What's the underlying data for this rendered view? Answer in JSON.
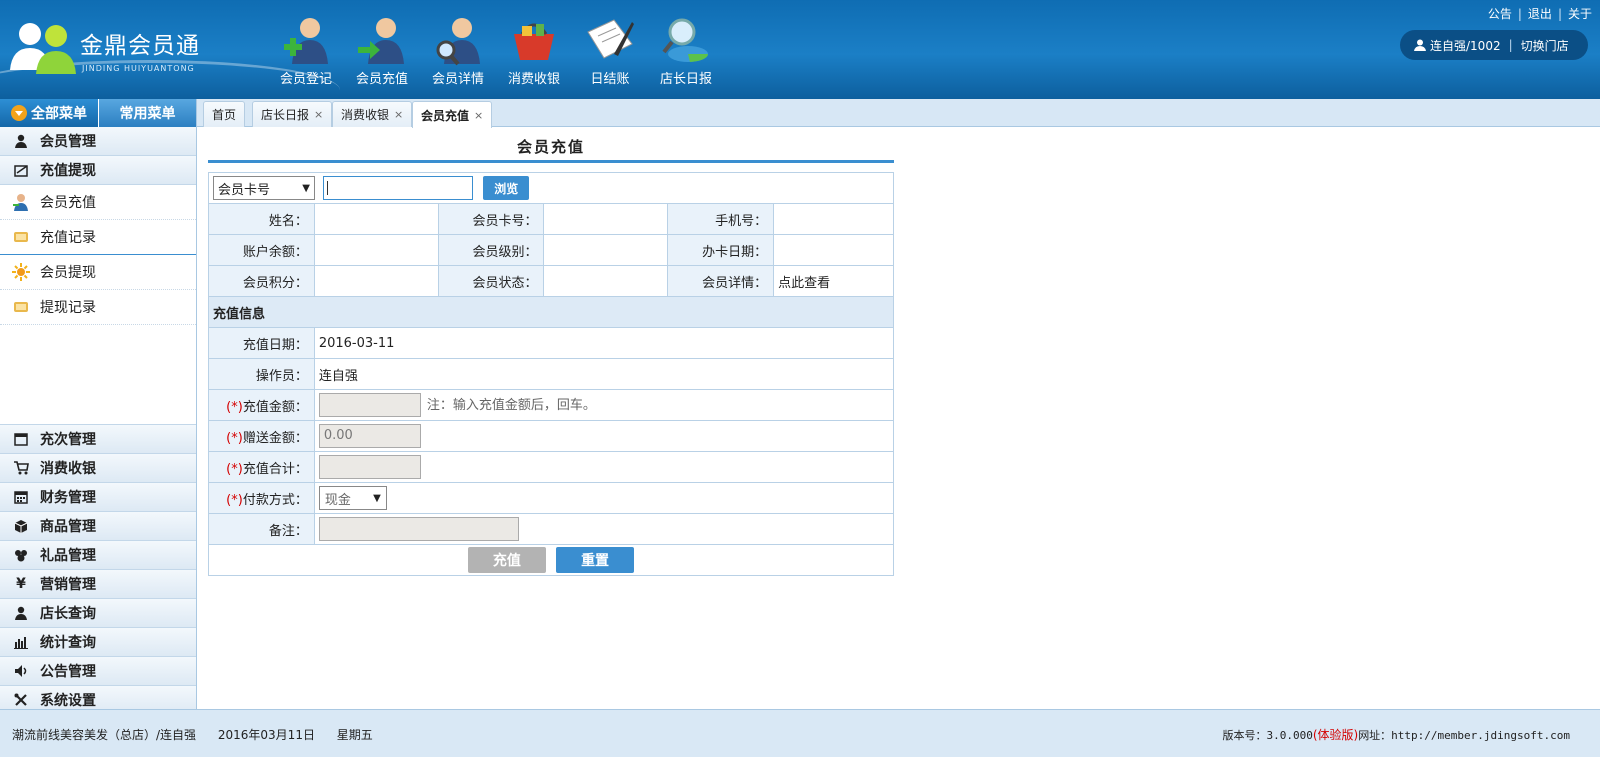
{
  "header": {
    "brand": "金鼎会员通",
    "brand_sub": "JINDING HUIYUANTONG",
    "nav": [
      {
        "label": "会员登记",
        "icon": "member-register-icon"
      },
      {
        "label": "会员充值",
        "icon": "member-recharge-icon"
      },
      {
        "label": "会员详情",
        "icon": "member-details-icon"
      },
      {
        "label": "消费收银",
        "icon": "shopping-basket-icon"
      },
      {
        "label": "日结账",
        "icon": "daily-ledger-icon"
      },
      {
        "label": "店长日报",
        "icon": "report-magnifier-icon"
      }
    ],
    "toplinks": {
      "notice": "公告",
      "logout": "退出",
      "about": "关于",
      "sep": "|"
    },
    "user": "连自强/1002",
    "switch_store": "切换门店",
    "user_sep": "|"
  },
  "sidebar": {
    "tab_all": "全部菜单",
    "tab_common": "常用菜单",
    "groups_top": [
      {
        "label": "会员管理",
        "icon": "person-icon"
      },
      {
        "label": "充值提现",
        "icon": "ledger-icon"
      }
    ],
    "sub_items": [
      {
        "label": "会员充值",
        "icon": "user-icon"
      },
      {
        "label": "充值记录",
        "icon": "scroll-icon"
      },
      {
        "label": "会员提现",
        "icon": "sun-icon"
      },
      {
        "label": "提现记录",
        "icon": "scroll-icon"
      }
    ],
    "groups_bottom": [
      {
        "label": "充次管理",
        "icon": "window-icon"
      },
      {
        "label": "消费收银",
        "icon": "cart-icon"
      },
      {
        "label": "财务管理",
        "icon": "calendar-icon"
      },
      {
        "label": "商品管理",
        "icon": "box-icon"
      },
      {
        "label": "礼品管理",
        "icon": "gift-icon"
      },
      {
        "label": "营销管理",
        "icon": "yen-icon"
      },
      {
        "label": "店长查询",
        "icon": "person-icon"
      },
      {
        "label": "统计查询",
        "icon": "bar-chart-icon"
      },
      {
        "label": "公告管理",
        "icon": "speaker-icon"
      },
      {
        "label": "系统设置",
        "icon": "tools-icon"
      }
    ]
  },
  "tabs": [
    {
      "label": "首页",
      "closable": false
    },
    {
      "label": "店长日报",
      "closable": true
    },
    {
      "label": "消费收银",
      "closable": true
    },
    {
      "label": "会员充值",
      "closable": true,
      "active": true
    }
  ],
  "tab_close_glyph": "×",
  "form": {
    "title": "会员充值",
    "search_type": "会员卡号",
    "search_value": "",
    "browse_label": "浏览",
    "labels": {
      "name": "姓名：",
      "card_no": "会员卡号：",
      "phone": "手机号：",
      "balance": "账户余额：",
      "level": "会员级别：",
      "open_date": "办卡日期：",
      "points": "会员积分：",
      "status": "会员状态：",
      "detail": "会员详情："
    },
    "detail_link": "点此查看",
    "section": "充值信息",
    "recharge_date_label": "充值日期：",
    "recharge_date": "2016-03-11",
    "operator_label": "操作员：",
    "operator": "连自强",
    "required_mark": "(*)",
    "amount_label": "充值金额：",
    "amount_note": "注：输入充值金额后，回车。",
    "gift_label": "赠送金额：",
    "gift_value": "0.00",
    "total_label": "充值合计：",
    "pay_label": "付款方式：",
    "pay_value": "现金",
    "remark_label": "备注：",
    "submit": "充值",
    "reset": "重置"
  },
  "footer": {
    "store": "潮流前线美容美发（总店）/连自强",
    "date": "2016年03月11日",
    "weekday": "星期五",
    "version_label": "版本号：3.0.000",
    "trial": "(体验版)",
    "site_label": "网址：http://member.jdingsoft.com"
  },
  "colors": {
    "accent": "#3a8ed0",
    "header": "#1b7fc6",
    "required": "#d40000"
  }
}
